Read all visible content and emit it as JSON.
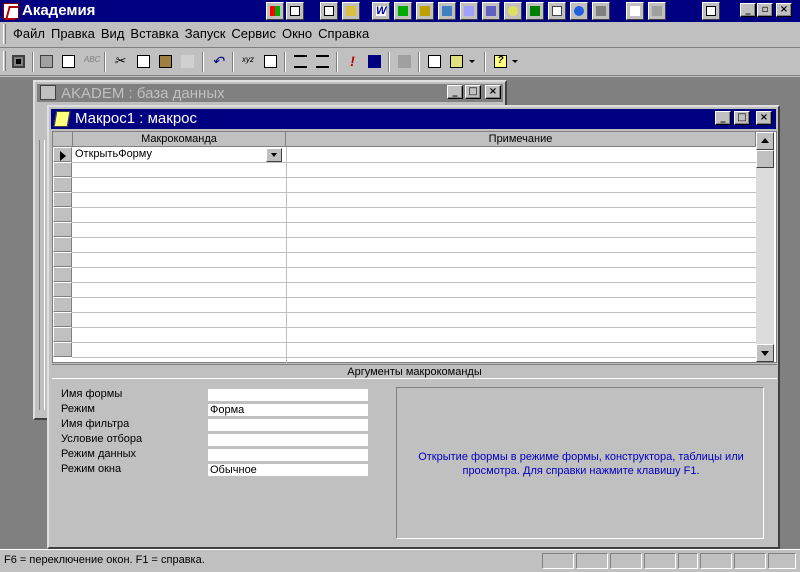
{
  "app": {
    "title": "Академия"
  },
  "menu": {
    "items": [
      "Файл",
      "Правка",
      "Вид",
      "Вставка",
      "Запуск",
      "Сервис",
      "Окно",
      "Справка"
    ]
  },
  "db_window": {
    "title": "AKADEM : база данных"
  },
  "macro_window": {
    "title": "Макрос1 : макрос",
    "columns": [
      "Макрокоманда",
      "Примечание"
    ],
    "rows": [
      {
        "action": "ОткрытьФорму",
        "note": ""
      }
    ],
    "args_header": "Аргументы макрокоманды",
    "args": [
      {
        "label": "Имя формы",
        "value": ""
      },
      {
        "label": "Режим",
        "value": "Форма"
      },
      {
        "label": "Имя фильтра",
        "value": ""
      },
      {
        "label": "Условие отбора",
        "value": ""
      },
      {
        "label": "Режим данных",
        "value": ""
      },
      {
        "label": "Режим окна",
        "value": "Обычное"
      }
    ],
    "help_text": "Открытие формы в режиме формы, конструктора, таблицы или просмотра. Для справки нажмите клавишу F1."
  },
  "status": {
    "text": "F6 = переключение окон.  F1 = справка."
  },
  "toolbar": {
    "icons": [
      "save-icon",
      "print-icon",
      "print-preview-icon",
      "spelling-icon",
      "cut-icon",
      "copy-icon",
      "paste-icon",
      "format-painter-icon",
      "undo-icon",
      "macro-names-icon",
      "conditions-icon",
      "insert-row-icon",
      "delete-row-icon",
      "run-icon",
      "single-step-icon",
      "build-icon",
      "database-window-icon",
      "new-object-icon",
      "help-icon"
    ]
  },
  "colors": {
    "title_active": "#000080",
    "title_inactive": "#808080",
    "help_text": "#0000c0"
  }
}
